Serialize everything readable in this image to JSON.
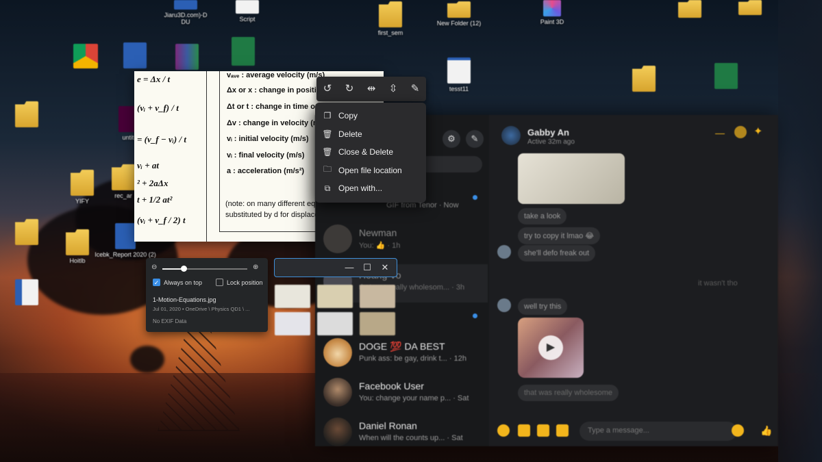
{
  "desktop": {
    "icons": [
      {
        "label": "Script",
        "kind": "doc"
      },
      {
        "label": "first_sem",
        "kind": "folder"
      },
      {
        "label": "New Folder (12)",
        "kind": "folder"
      },
      {
        "label": "Paint 3D",
        "kind": "paint3d"
      },
      {
        "label": "tesst11",
        "kind": "word"
      },
      {
        "label": "YIFY",
        "kind": "folder"
      },
      {
        "label": "rec_ar",
        "kind": "folder"
      },
      {
        "label": "Hoitlb",
        "kind": "folder"
      },
      {
        "label": "Icebk_Report 2020 (2)",
        "kind": "word"
      },
      {
        "label": "untit",
        "kind": "xd"
      }
    ],
    "partial_labels": {
      "top_center": "Jiaru3D.com)-D",
      "top_center2": "DU",
      "word_icon": "Icebk_Report 2020 (2)"
    }
  },
  "formula_image": {
    "formulas": [
      "e = Δx / t",
      "(vᵢ + v_f) / t",
      "= (v_f − vᵢ) / t",
      "vᵢ + at",
      "² + 2aΔx",
      "t + 1/2 at²",
      "(vᵢ + v_f / 2) t"
    ],
    "definitions": [
      "vₐᵥₑ : average velocity (m/s)",
      "Δx or x : change in positio",
      "Δt or t : change in time or",
      "Δv :  change in velocity (m",
      "vᵢ : initial velocity (m/s)",
      "vᵢ : final velocity (m/s)",
      "a : acceleration (m/s²)"
    ],
    "note": "(note: on many different equation sheets x is substituted by d for displacement)"
  },
  "toolbar": {
    "buttons": [
      {
        "name": "rotate-left",
        "glyph": "↺"
      },
      {
        "name": "rotate-right",
        "glyph": "↻"
      },
      {
        "name": "flip-horizontal",
        "glyph": "⇹"
      },
      {
        "name": "flip-vertical",
        "glyph": "⇳"
      },
      {
        "name": "edit",
        "glyph": "✎"
      }
    ]
  },
  "context_menu": {
    "items": [
      {
        "label": "Copy",
        "icon": "copy-icon",
        "glyph": "❐"
      },
      {
        "label": "Delete",
        "icon": "trash-icon",
        "glyph": "🗑"
      },
      {
        "label": "Close & Delete",
        "icon": "trash-icon",
        "glyph": "🗑"
      },
      {
        "label": "Open file location",
        "icon": "folder-location-icon",
        "glyph": "🗀"
      },
      {
        "label": "Open with...",
        "icon": "open-external-icon",
        "glyph": "⧉"
      }
    ]
  },
  "photo_options": {
    "zoom_level": 0.25,
    "always_on_top_label": "Always on top",
    "always_on_top_checked": true,
    "lock_position_label": "Lock position",
    "lock_position_checked": false,
    "file_name": "1-Motion-Equations.jpg",
    "file_meta": "Jul 01, 2020 • OneDrive \\ Physics QD1 \\ ...",
    "exif": "No EXIF Data"
  },
  "thumb_window": {
    "minimize": "—",
    "maximize": "☐",
    "close": "✕"
  },
  "messenger": {
    "header_name": "Gabby An",
    "header_status": "Active 32m ago",
    "conversations": [
      {
        "name": "Newman",
        "preview": "You: 👍 · 1h",
        "dim": true
      },
      {
        "name": "Hoang Vo",
        "preview": "that was really wholesom... · 3h",
        "dim": true
      },
      {
        "name": "DOGE 💯 DA BEST",
        "preview": "Punk ass: be gay, drink t... · 12h",
        "dim": false
      },
      {
        "name": "Facebook User",
        "preview": "You: change your name p... · Sat",
        "dim": false
      },
      {
        "name": "Daniel Ronan",
        "preview": "When will the counts up... · Sat",
        "dim": false
      }
    ],
    "top_preview": "GIF from Tenor · Now",
    "messages": [
      "take a look",
      "try to copy it lmao 😂",
      "she'll defo freak out",
      "well try this",
      "that was really wholesome",
      "it wasn't tho"
    ],
    "input_placeholder": "Type a message..."
  },
  "colors": {
    "accent_blue": "#3a8ee6",
    "messenger_yellow": "#f2b51c",
    "menu_bg": "#2b2b2d"
  }
}
